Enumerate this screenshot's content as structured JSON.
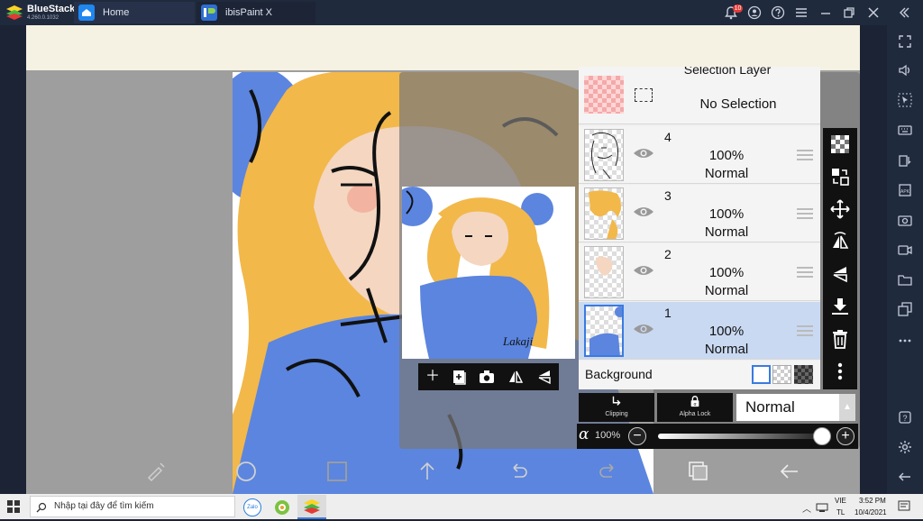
{
  "titlebar": {
    "app_name": "BlueStacks",
    "app_version": "4.260.0.1032",
    "notification_count": "10",
    "tabs": [
      {
        "label": "Home"
      },
      {
        "label": "ibisPaint X"
      }
    ]
  },
  "layers_panel": {
    "selection_layer_title": "Selection Layer",
    "selection_status": "No Selection",
    "layers": [
      {
        "number": "4",
        "opacity": "100%",
        "blend": "Normal"
      },
      {
        "number": "3",
        "opacity": "100%",
        "blend": "Normal"
      },
      {
        "number": "2",
        "opacity": "100%",
        "blend": "Normal"
      },
      {
        "number": "1",
        "opacity": "100%",
        "blend": "Normal",
        "selected": true
      }
    ],
    "background_label": "Background"
  },
  "bottom_controls": {
    "clipping_label": "Clipping",
    "alpha_lock_label": "Alpha Lock",
    "blend_mode": "Normal",
    "alpha_symbol": "α",
    "alpha_value": "100%",
    "alpha_fraction": 1.0
  },
  "artwork": {
    "signature": "Lakaji"
  },
  "taskbar": {
    "search_placeholder": "Nhập tại đây để tìm kiếm",
    "lang_top": "VIE",
    "lang_bottom": "TL",
    "time": "3:52 PM",
    "date": "10/4/2021"
  },
  "colors": {
    "accent": "#3a7be0",
    "hair": "#f2b84a",
    "dress": "#5b85df",
    "skin": "#f4d6c1"
  }
}
